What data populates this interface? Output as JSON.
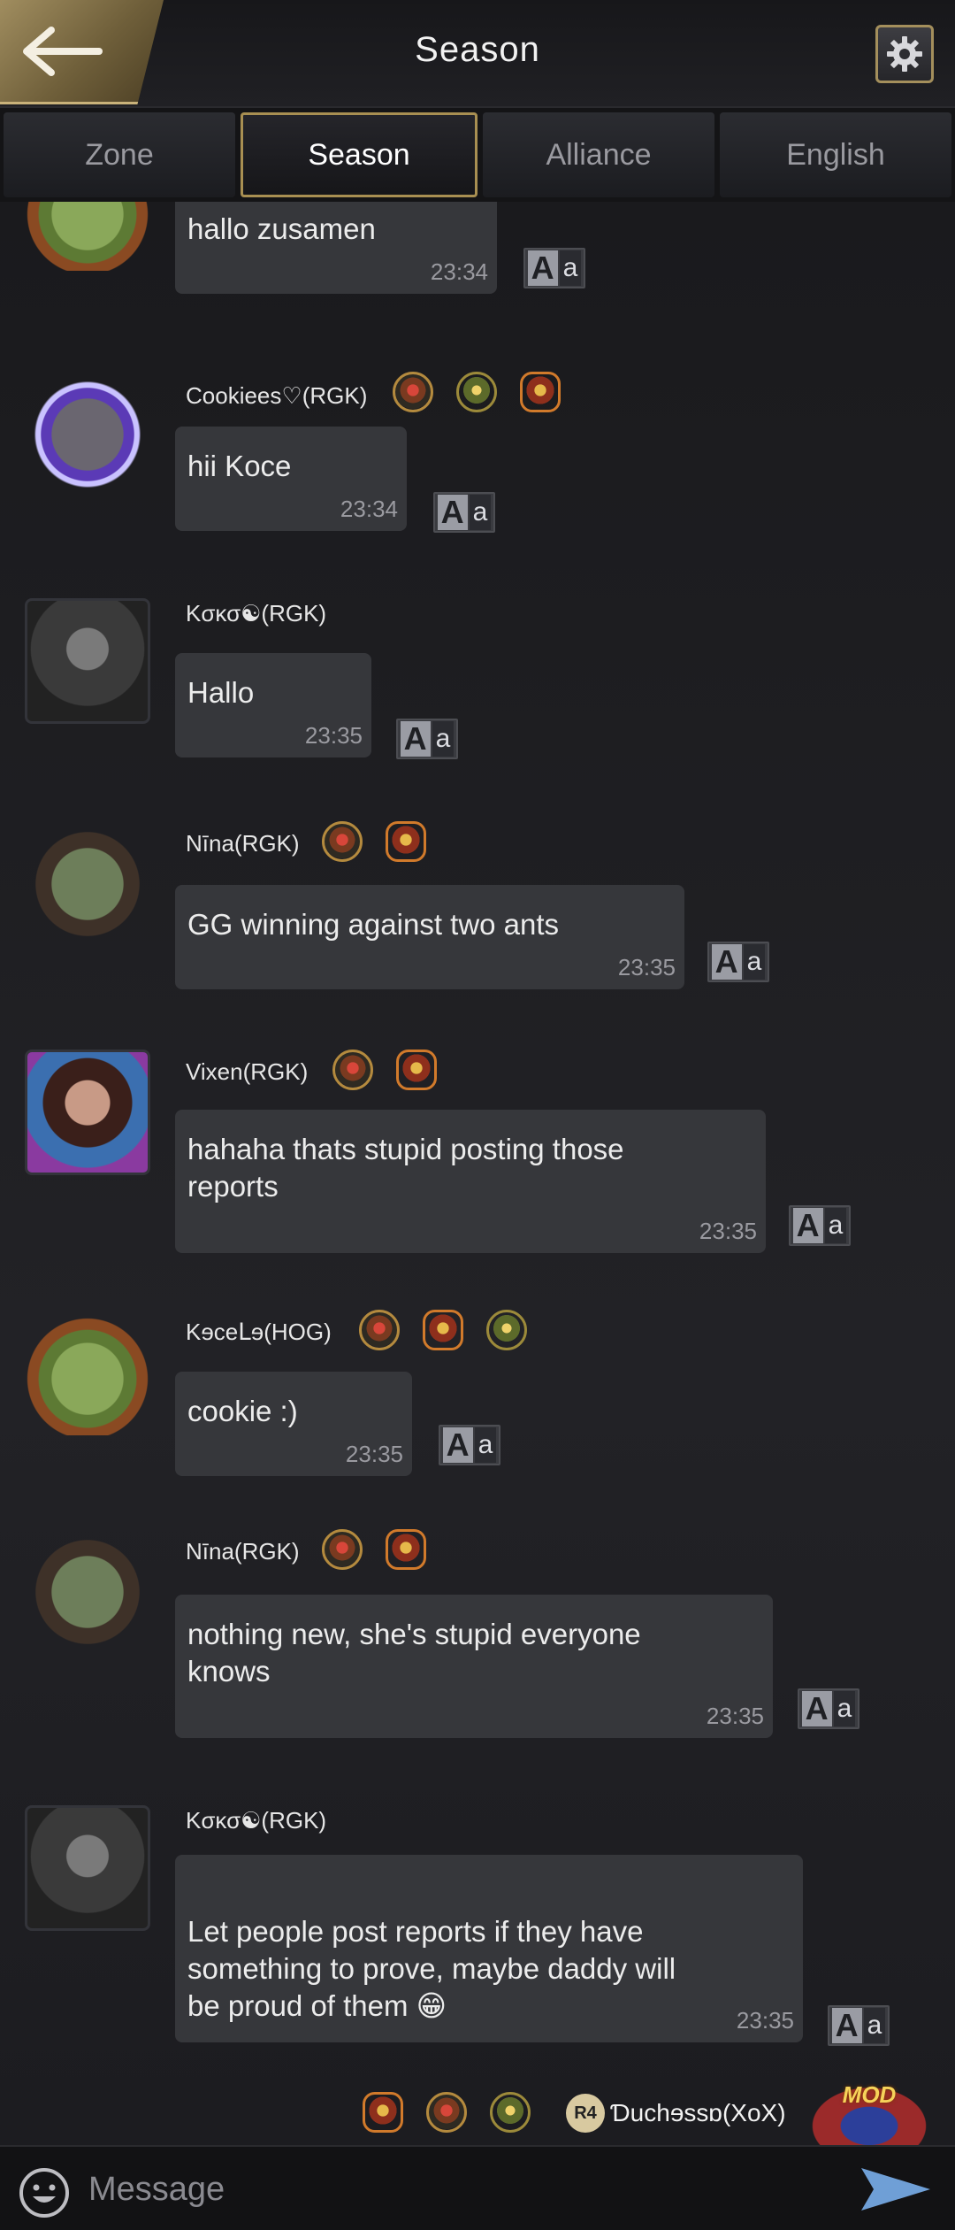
{
  "header": {
    "title": "Season"
  },
  "tabs": [
    {
      "label": "Zone",
      "active": false
    },
    {
      "label": "Season",
      "active": true
    },
    {
      "label": "Alliance",
      "active": false
    },
    {
      "label": "English",
      "active": false
    }
  ],
  "messages": [
    {
      "user": "",
      "text": "hallo zusamen",
      "time": "23:34",
      "avatar": "nature-frame"
    },
    {
      "user": "Cookiees♡(RGK)",
      "text": "hii Koce",
      "time": "23:34",
      "avatar": "crystal-frame"
    },
    {
      "user": "Kσκσ☯(RGK)",
      "text": "Hallo",
      "time": "23:35",
      "avatar": "photo"
    },
    {
      "user": "Nīna(RGK)",
      "text": "GG winning against two ants",
      "time": "23:35",
      "avatar": "flower-frame"
    },
    {
      "user": "Vixen(RGK)",
      "text": "hahaha thats stupid posting those reports",
      "time": "23:35",
      "avatar": "photo"
    },
    {
      "user": "Kɘceᒪɘ(HOG)",
      "text": "cookie :)",
      "time": "23:35",
      "avatar": "nature-frame"
    },
    {
      "user": "Nīna(RGK)",
      "text": "nothing new, she's stupid everyone knows",
      "time": "23:35",
      "avatar": "flower-frame"
    },
    {
      "user": "Kσκσ☯(RGK)",
      "text": "Let people post reports if they have something to prove, maybe daddy will\n be proud of them 😁",
      "time": "23:35",
      "avatar": "photo"
    }
  ],
  "translate": {
    "big": "A",
    "small": "a"
  },
  "own_user": {
    "rank": "R4",
    "name": "Ɗuchɘssɒ(XoX)",
    "badge": "MOD"
  },
  "input": {
    "placeholder": "Message"
  },
  "colors": {
    "accent_gold": "#a88f52",
    "bubble": "#36373b",
    "background": "#1d1d21"
  }
}
